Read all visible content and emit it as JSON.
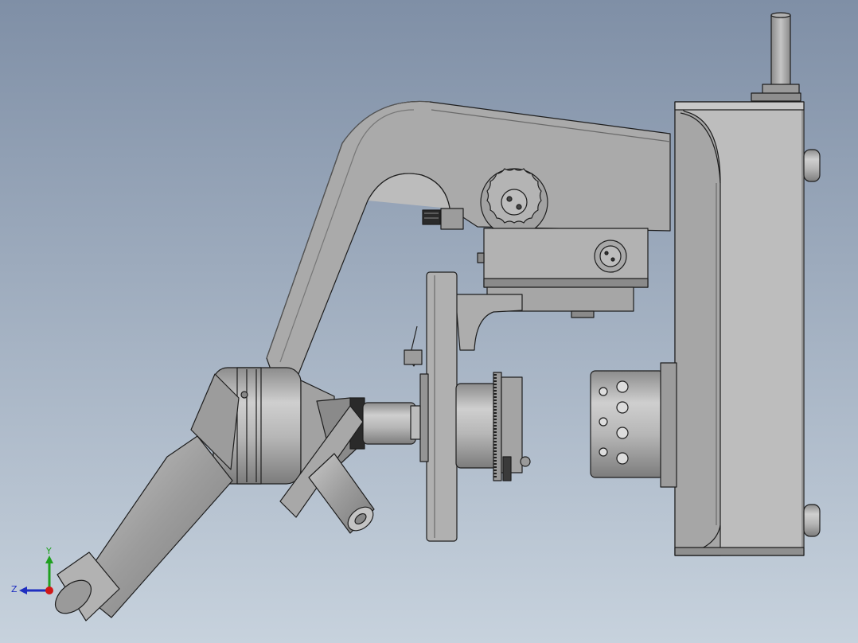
{
  "viewport": {
    "background_top": "#7f8fa6",
    "background_bottom": "#c7d2dd"
  },
  "model": {
    "body_color": "#a4a4a4",
    "edge_color": "#1e1e1e"
  },
  "triad": {
    "y_label": "Y",
    "z_label": "Z",
    "y_color": "#1fa01f",
    "z_color": "#1f2fc0",
    "x_color": "#d01818"
  }
}
